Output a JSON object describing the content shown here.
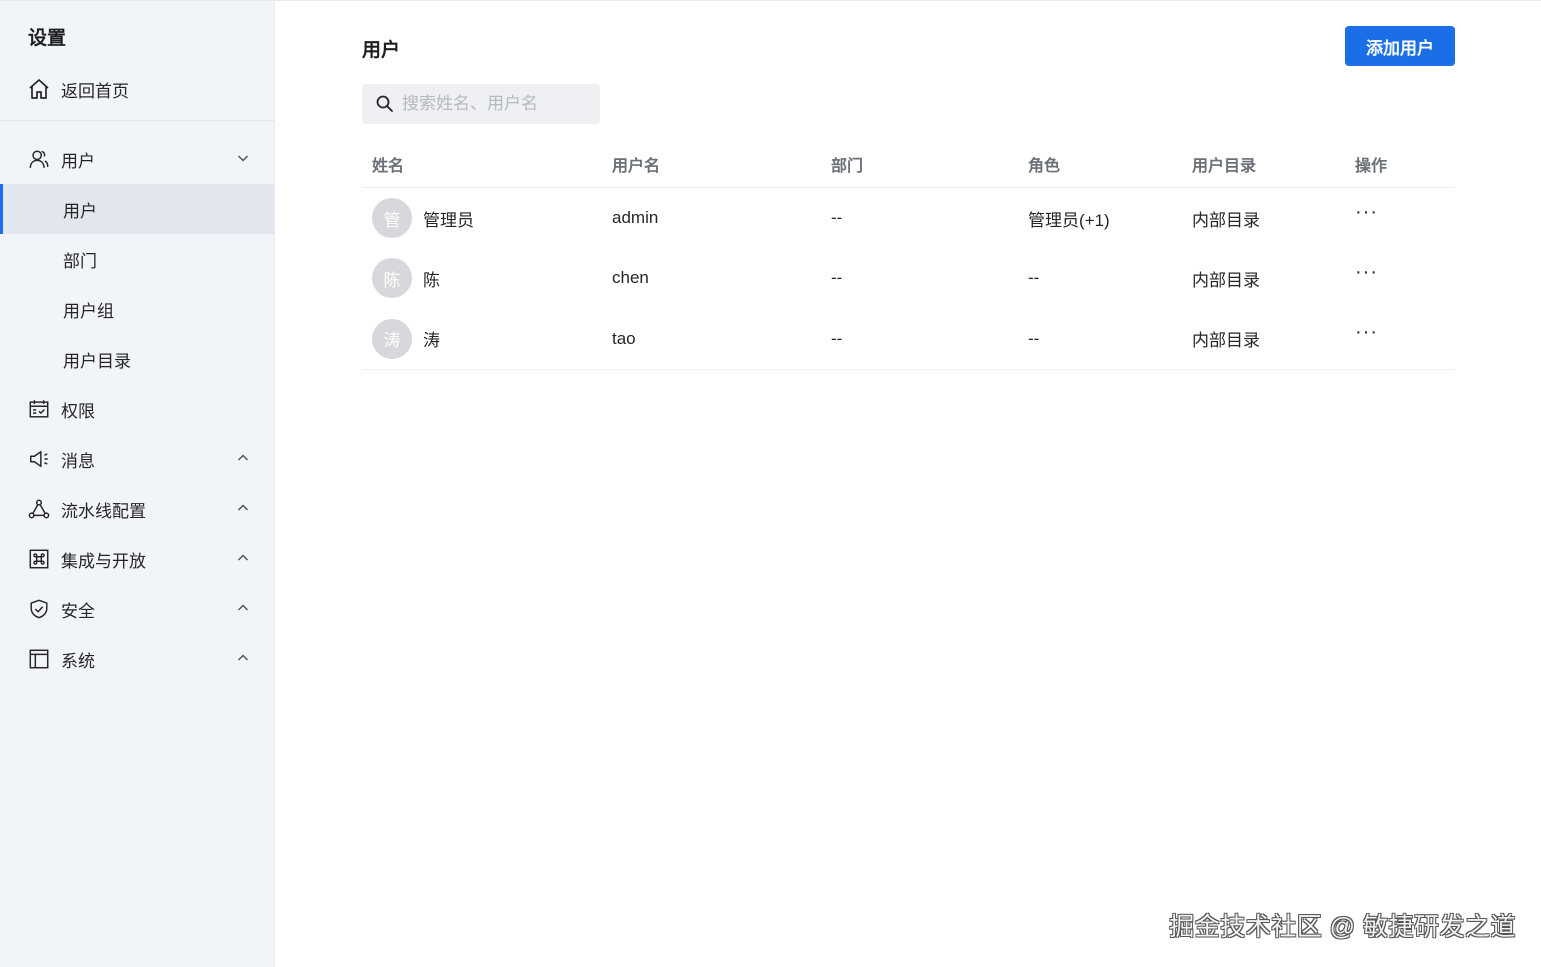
{
  "sidebar": {
    "title": "设置",
    "home_label": "返回首页",
    "items": [
      {
        "label": "用户",
        "icon": "user-icon",
        "chevron": "down"
      },
      {
        "label": "用户",
        "sub": true,
        "active": true
      },
      {
        "label": "部门",
        "sub": true
      },
      {
        "label": "用户组",
        "sub": true
      },
      {
        "label": "用户目录",
        "sub": true
      },
      {
        "label": "权限",
        "icon": "calendar-check-icon"
      },
      {
        "label": "消息",
        "icon": "megaphone-icon",
        "chevron": "up"
      },
      {
        "label": "流水线配置",
        "icon": "pipeline-icon",
        "chevron": "up"
      },
      {
        "label": "集成与开放",
        "icon": "command-icon",
        "chevron": "up"
      },
      {
        "label": "安全",
        "icon": "shield-icon",
        "chevron": "up"
      },
      {
        "label": "系统",
        "icon": "layout-icon",
        "chevron": "up"
      }
    ]
  },
  "main": {
    "title": "用户",
    "add_button": "添加用户",
    "search_placeholder": "搜索姓名、用户名",
    "columns": [
      "姓名",
      "用户名",
      "部门",
      "角色",
      "用户目录",
      "操作"
    ],
    "rows": [
      {
        "avatar": "管",
        "name": "管理员",
        "username": "admin",
        "dept": "--",
        "role": "管理员(+1)",
        "directory": "内部目录",
        "action": "···"
      },
      {
        "avatar": "陈",
        "name": "陈",
        "username": "chen",
        "dept": "--",
        "role": "--",
        "directory": "内部目录",
        "action": "···"
      },
      {
        "avatar": "涛",
        "name": "涛",
        "username": "tao",
        "dept": "--",
        "role": "--",
        "directory": "内部目录",
        "action": "···"
      }
    ]
  },
  "watermark": "掘金技术社区 @ 敏捷研发之道",
  "colors": {
    "accent": "#1a6fe8",
    "sidebar_bg": "#f1f4f9",
    "active_bg": "#e2e7ef",
    "avatar_bg": "#d6d8dc"
  }
}
